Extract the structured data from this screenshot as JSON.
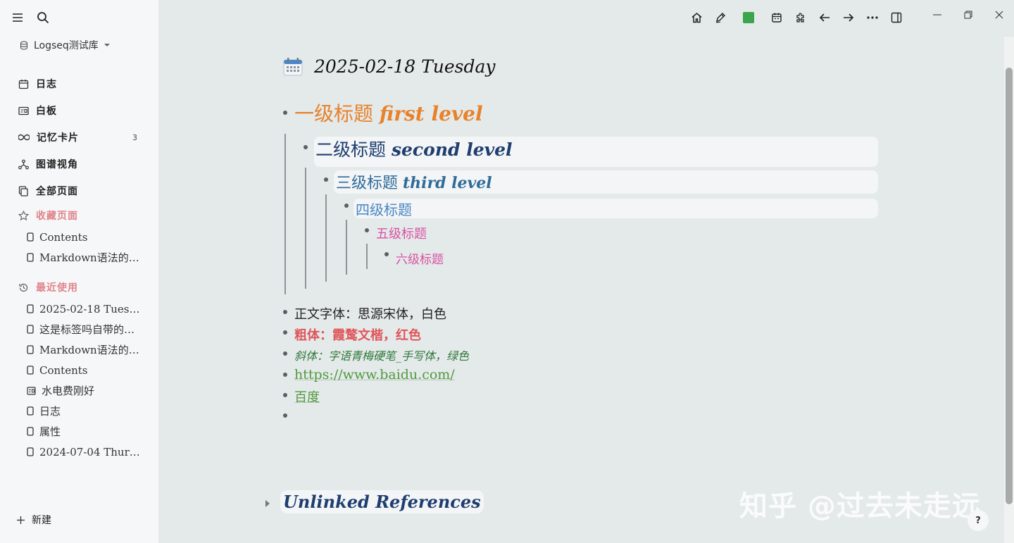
{
  "sidebar": {
    "graph_name": "Logseq测试库",
    "nav": [
      {
        "label": "日志",
        "icon": "calendar-icon"
      },
      {
        "label": "白板",
        "icon": "whiteboard-icon"
      },
      {
        "label": "记忆卡片",
        "icon": "infinity-icon",
        "count": "3"
      },
      {
        "label": "图谱视角",
        "icon": "graph-icon"
      },
      {
        "label": "全部页面",
        "icon": "pages-icon"
      }
    ],
    "favorites_title": "收藏页面",
    "favorites": [
      "Contents",
      "Markdown语法的…"
    ],
    "recent_title": "最近使用",
    "recent": [
      "2025-02-18 Tuesday",
      "这是标签吗自带的…",
      "Markdown语法的…",
      "Contents",
      "水电费刚好",
      "日志",
      "属性",
      "2024-07-04 Thurs…"
    ],
    "new_label": "新建"
  },
  "page": {
    "title": "2025-02-18 Tuesday",
    "h1_cn": "一级标题 ",
    "h1_en": "first level",
    "h2_cn": "二级标题 ",
    "h2_en": "second level",
    "h3_cn": "三级标题 ",
    "h3_en": "third level",
    "h4": "四级标题",
    "h5": "五级标题",
    "h6": "六级标题",
    "normal": "正文字体：思源宋体，白色",
    "bold": "粗体：霞鹜文楷，红色",
    "italic": "斜体：字语青梅硬笔_手写体，绿色",
    "link": "https://www.baidu.com/",
    "link2": "百度",
    "unlinked": "Unlinked References"
  },
  "watermark": "知乎 @过去未走远",
  "help": "?",
  "colors": {
    "accent": "#e0848a",
    "h1": "#e8822a",
    "h2": "#1f3e70",
    "link": "#4f9a3d",
    "bold": "#e0555a"
  }
}
